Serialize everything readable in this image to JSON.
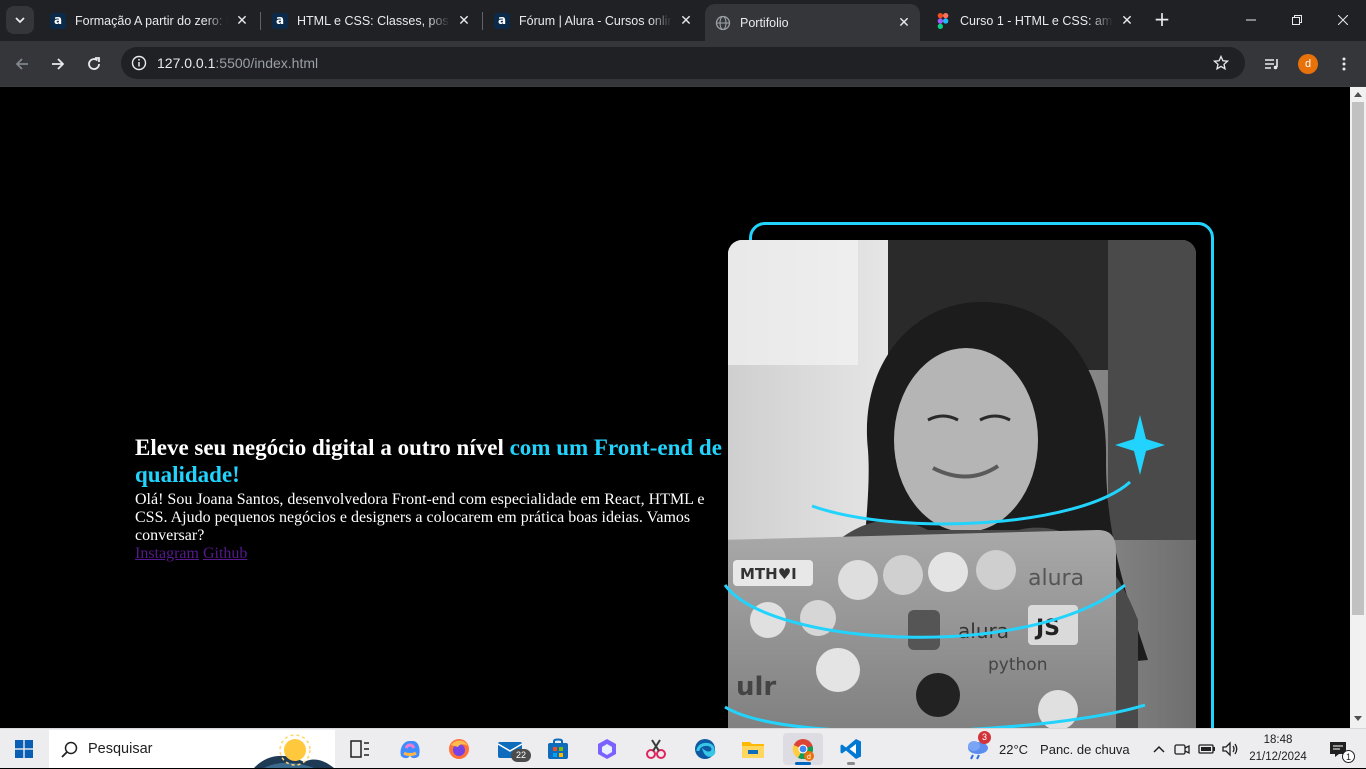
{
  "browser": {
    "tabs": [
      {
        "title": "Formação A partir do zero: H",
        "favicon": "alura-icon",
        "active": false
      },
      {
        "title": "HTML e CSS: Classes, posicio",
        "favicon": "alura-icon",
        "active": false
      },
      {
        "title": "Fórum | Alura - Cursos onlin",
        "favicon": "alura-icon",
        "active": false
      },
      {
        "title": "Portifolio",
        "favicon": "globe-icon",
        "active": true
      },
      {
        "title": "Curso 1 - HTML e CSS: ambi",
        "favicon": "figma-icon",
        "active": false
      }
    ],
    "url_host": "127.0.0.1",
    "url_rest": ":5500/index.html",
    "profile_initial": "d",
    "accent_color": "#e8710a"
  },
  "page": {
    "title_main": "Eleve seu negócio digital a outro nível ",
    "title_accent": "com um Front-end de qualidade!",
    "description": "Olá! Sou Joana Santos, desenvolvedora Front-end com especialidade em React, HTML e CSS. Ajudo pequenos negócios e designers a colocarem em prática boas ideias. Vamos conversar?",
    "links": [
      {
        "label": "Instagram"
      },
      {
        "label": "Github"
      }
    ],
    "accent_color": "#22d4fd",
    "background_color": "#000000"
  },
  "taskbar": {
    "search_label": "Pesquisar",
    "mail_badge": "22",
    "weather_badge": "3",
    "temperature": "22°C",
    "weather_text": "Panc. de chuva",
    "time": "18:48",
    "date": "21/12/2024",
    "notification_count": "1"
  }
}
